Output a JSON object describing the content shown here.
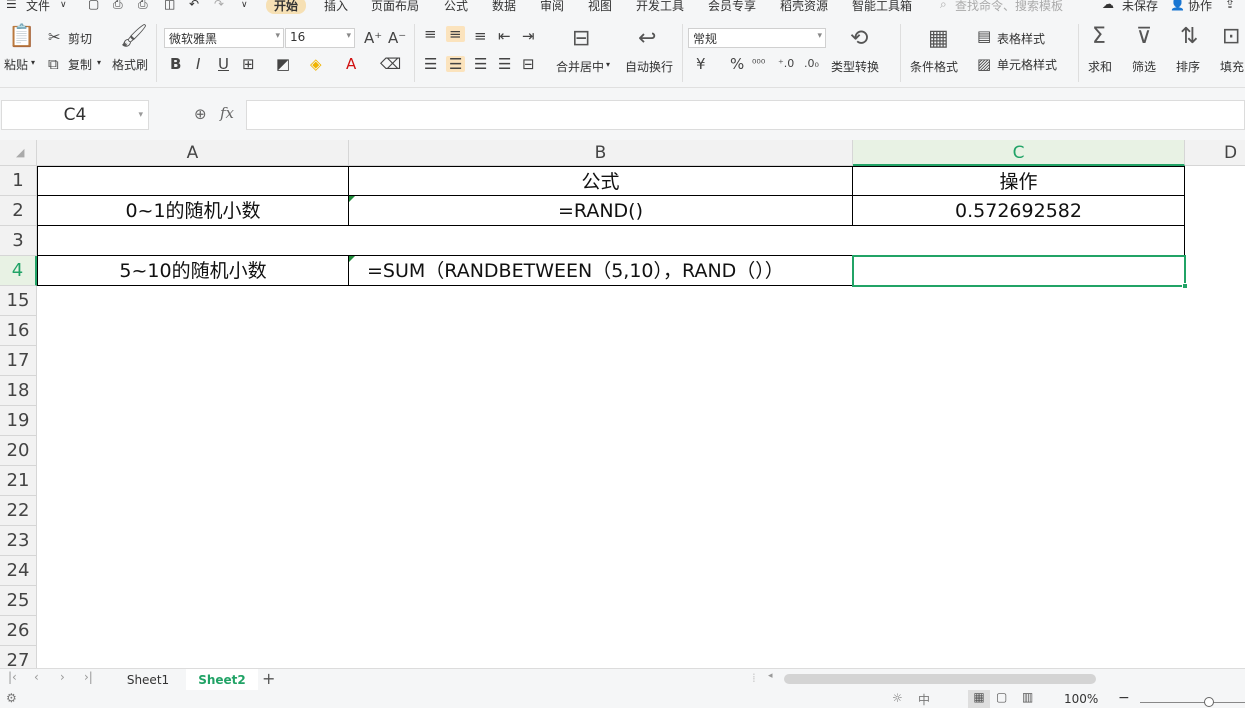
{
  "menu": {
    "file": "文件",
    "tabs": [
      "开始",
      "插入",
      "页面布局",
      "公式",
      "数据",
      "审阅",
      "视图",
      "开发工具",
      "会员专享",
      "稻壳资源",
      "智能工具箱"
    ],
    "active_tab": "开始",
    "search_placeholder": "查找命令、搜索模板",
    "unsaved": "未保存",
    "collab": "协作"
  },
  "ribbon": {
    "paste": "粘贴",
    "cut": "剪切",
    "copy": "复制",
    "format_painter": "格式刷",
    "font_name": "微软雅黑",
    "font_size": "16",
    "merge_center": "合并居中",
    "wrap_text": "自动换行",
    "number_format": "常规",
    "type_convert": "类型转换",
    "cond_format": "条件格式",
    "table_style": "表格样式",
    "cell_style": "单元格样式",
    "sum": "求和",
    "filter": "筛选",
    "sort": "排序",
    "fill": "填充",
    "currency_symbol": "¥",
    "percent_symbol": "%"
  },
  "formula_bar": {
    "name_box": "C4",
    "fx": "fx",
    "formula": ""
  },
  "grid": {
    "columns": [
      "A",
      "B",
      "C",
      "D"
    ],
    "active_column": "C",
    "rows": [
      "1",
      "2",
      "3",
      "4",
      "15",
      "16",
      "17",
      "18",
      "19",
      "20",
      "21",
      "22",
      "23",
      "24",
      "25",
      "26",
      "27"
    ],
    "active_row": "4",
    "cells": {
      "B1": "公式",
      "C1": "操作",
      "A2": "0~1的随机小数",
      "B2": "=RAND()",
      "C2": "0.572692582",
      "A4": "5~10的随机小数",
      "B4": "=SUM（RANDBETWEEN（5,10），RAND（））",
      "C4": ""
    }
  },
  "sheets": {
    "tabs": [
      "Sheet1",
      "Sheet2"
    ],
    "active": "Sheet2",
    "add": "+"
  },
  "status": {
    "zoom": "100%",
    "zoom_minus": "−"
  }
}
